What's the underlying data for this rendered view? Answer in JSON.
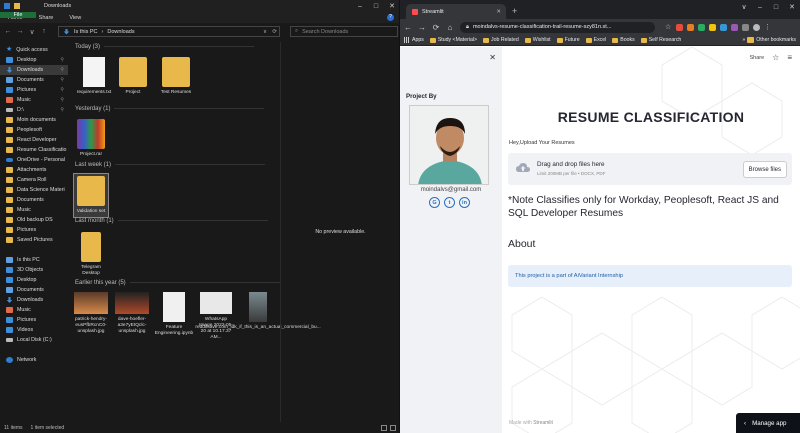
{
  "explorer": {
    "title": "Downloads",
    "window_controls": [
      "–",
      "□",
      "✕"
    ],
    "ribbon_tabs": [
      "File",
      "Home",
      "Share",
      "View"
    ],
    "help": "?",
    "nav_glyphs": [
      "←",
      "→",
      "∨",
      "↑"
    ],
    "breadcrumb": [
      "Is this PC",
      "Downloads"
    ],
    "search_placeholder": "Search Downloads",
    "sidebar": [
      {
        "label": "Quick access",
        "icon": "star-icon"
      },
      {
        "label": "Desktop",
        "icon": "desktop-icon",
        "pinned": true
      },
      {
        "label": "Downloads",
        "icon": "download-icon",
        "pinned": true,
        "selected": true
      },
      {
        "label": "Documents",
        "icon": "documents-icon",
        "pinned": true
      },
      {
        "label": "Pictures",
        "icon": "pictures-icon",
        "pinned": true
      },
      {
        "label": "Music",
        "icon": "music-icon",
        "pinned": true
      },
      {
        "label": "D:\\",
        "icon": "drive-icon",
        "pinned": true
      },
      {
        "label": "Moin documents",
        "icon": "folder-icon"
      },
      {
        "label": "Peoplesoft",
        "icon": "folder-icon"
      },
      {
        "label": "React Developer",
        "icon": "folder-icon"
      },
      {
        "label": "Resume Classificatio",
        "icon": "folder-icon"
      },
      {
        "label": "OneDrive - Personal",
        "icon": "cloud-icon"
      },
      {
        "label": "Attachments",
        "icon": "folder-icon"
      },
      {
        "label": "Camera Roll",
        "icon": "folder-icon"
      },
      {
        "label": "Data Science Materi",
        "icon": "folder-icon"
      },
      {
        "label": "Documents",
        "icon": "folder-icon"
      },
      {
        "label": "Music",
        "icon": "folder-icon"
      },
      {
        "label": "Old backup DS",
        "icon": "folder-icon"
      },
      {
        "label": "Pictures",
        "icon": "folder-icon"
      },
      {
        "label": "Saved Pictures",
        "icon": "folder-icon"
      },
      {
        "label": "",
        "icon": ""
      },
      {
        "label": "Is this PC",
        "icon": "pc-icon"
      },
      {
        "label": "3D Objects",
        "icon": "objects-icon"
      },
      {
        "label": "Desktop",
        "icon": "desktop-icon"
      },
      {
        "label": "Documents",
        "icon": "documents-icon"
      },
      {
        "label": "Downloads",
        "icon": "download-icon"
      },
      {
        "label": "Music",
        "icon": "music-icon"
      },
      {
        "label": "Pictures",
        "icon": "pictures-icon"
      },
      {
        "label": "Videos",
        "icon": "videos-icon"
      },
      {
        "label": "Local Disk (C:)",
        "icon": "drive-icon"
      },
      {
        "label": "",
        "icon": ""
      },
      {
        "label": "Network",
        "icon": "network-icon"
      }
    ],
    "groups": {
      "today": "Today (3)",
      "yesterday": "Yesterday (1)",
      "last_week": "Last week (1)",
      "last_month": "Last month (1)",
      "earlier": "Earlier this year (5)"
    },
    "files": {
      "requirements": "requirements.txt",
      "project": "Project",
      "test_resumes": "Test Resumes",
      "project_rar": "Project.rar",
      "validation_set": "Validation set",
      "telegram": "Telegram Desktop",
      "patrick": "patrick-hendry-eusPfbRcnC0-unsplash.jpg",
      "dave": "dave-hoefler-a3e7yEtQclc-unsplash.jpg",
      "feature": "Feature Engineering.ipynb",
      "whatsapp": "WhatsApp Image 2022-05-20 at 10.17.37 AM...",
      "reddit": "redditsave.com_idk_if_this_is_an_actual_commercial_bu..."
    },
    "preview": "No preview available.",
    "status": {
      "items": "11 items",
      "selected": "1 item selected"
    }
  },
  "chrome": {
    "tab_title": "Streamlit",
    "tab_close": "✕",
    "new_tab": "+",
    "window_controls": [
      "∨",
      "–",
      "□",
      "✕"
    ],
    "nav_glyphs": [
      "←",
      "→",
      "⟳",
      "⌂"
    ],
    "url": "moindalvs-resume-classification-trail-resume-szy81n.st...",
    "bookmarks": [
      "Apps",
      "Study <Material>",
      "Job Related",
      "Wishlist",
      "Future",
      "Excel",
      "Books",
      "Self Research"
    ],
    "bookmarks_more": "»",
    "other_bookmarks": "Other bookmarks"
  },
  "streamlit": {
    "close": "✕",
    "project_by": "Project By",
    "email": "moindalvs@gmail.com",
    "social": [
      "G",
      "t",
      "in"
    ],
    "share": "Share",
    "star": "☆",
    "menu": "≡",
    "title": "RESUME CLASSIFICATION",
    "upload_label": "Hey,Upload Your Resumes",
    "drop_text": "Drag and drop files here",
    "drop_limit": "Limit 200MB per file • DOCX, PDF",
    "browse": "Browse files",
    "note": "*Note Classifies only for Workday, Peoplesoft, React JS and SQL Developer Resumes",
    "about": "About",
    "info": "This project is a part of AiVariant Internship",
    "made_with": "Made with",
    "made_brand": "Streamlit",
    "manage_app": "Manage app",
    "manage_arrow": "‹"
  },
  "colors": {
    "explorer_bg": "#191919",
    "folder": "#e8b94a",
    "accent": "#3e8ede",
    "streamlit_info_text": "#1e5da6",
    "streamlit_info_bg": "#e7f0fa"
  }
}
